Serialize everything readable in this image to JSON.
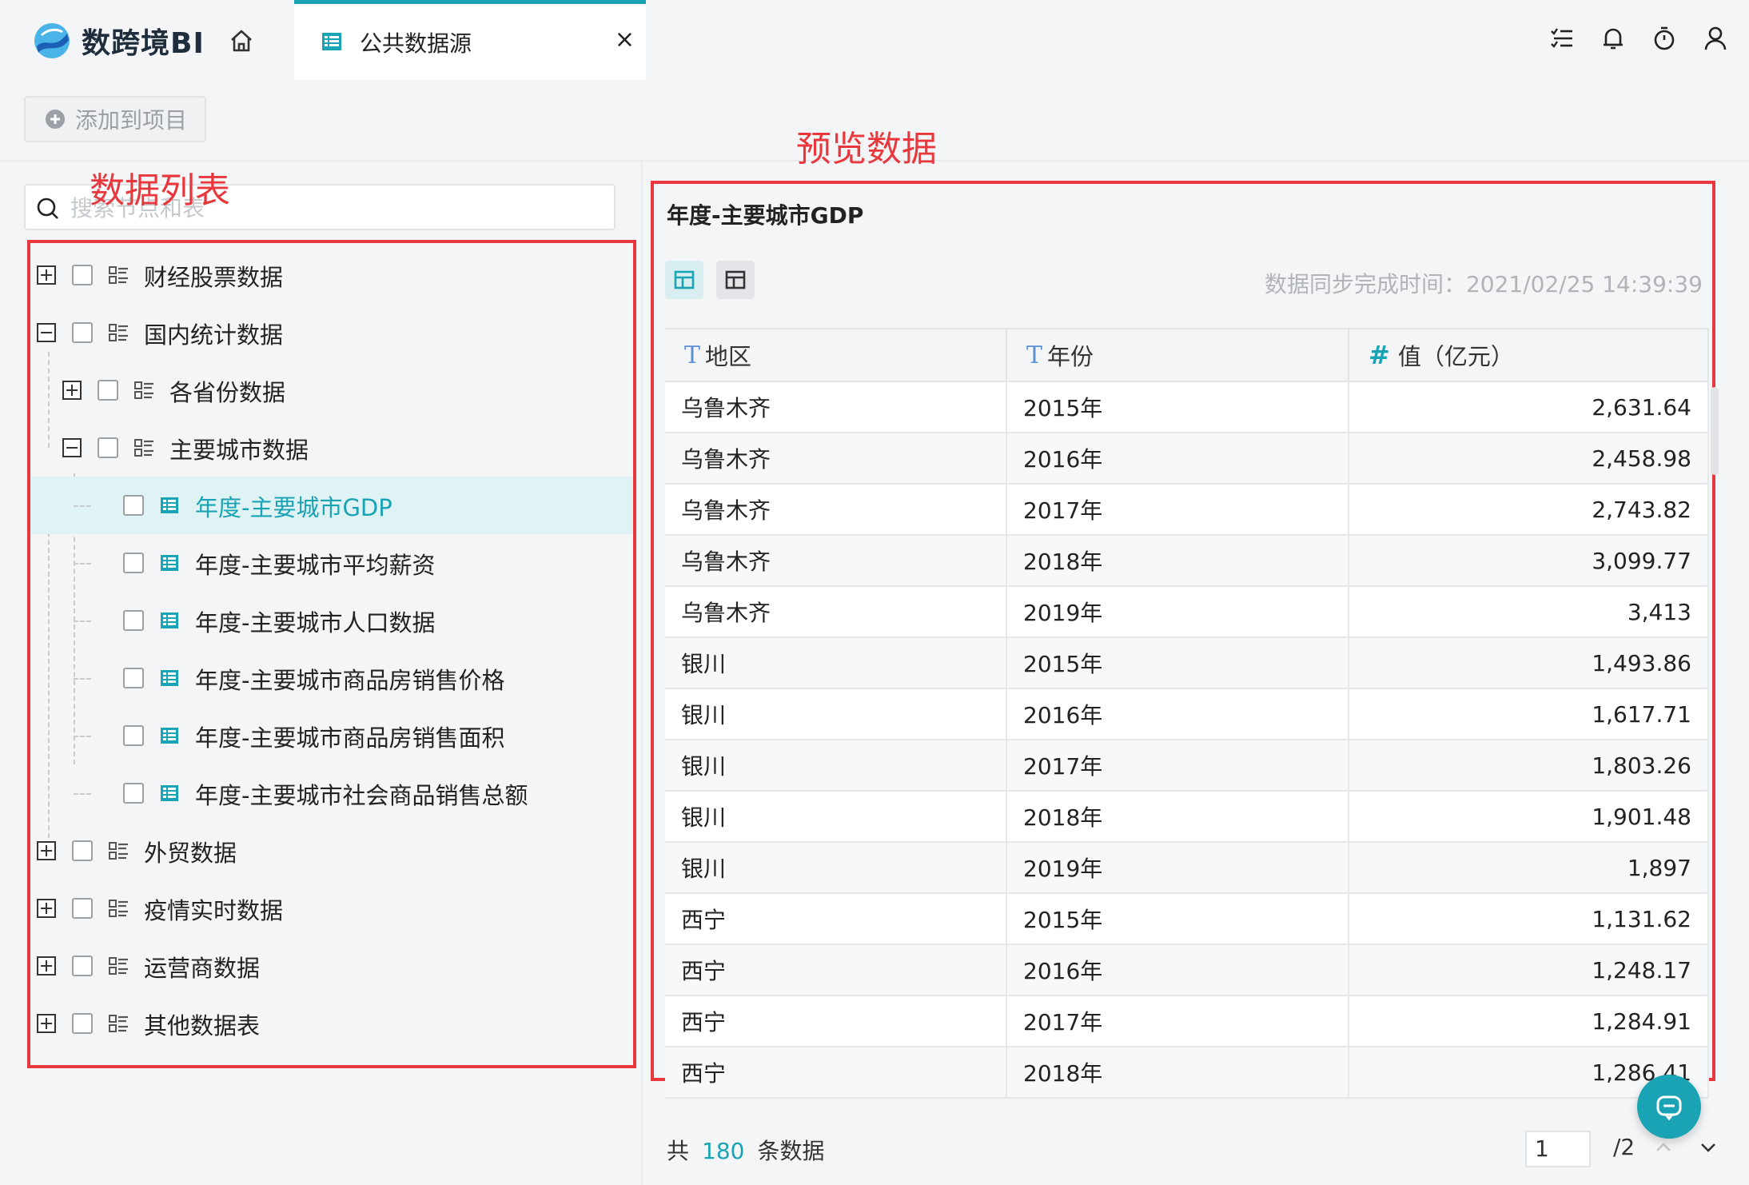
{
  "app": {
    "brand": "数跨境BI"
  },
  "tab": {
    "label": "公共数据源",
    "close": "×"
  },
  "toolbar": {
    "add_label": "添加到项目"
  },
  "search": {
    "placeholder": "搜索节点和表"
  },
  "annotations": {
    "list": "数据列表",
    "preview": "预览数据"
  },
  "tree": [
    {
      "label": "财经股票数据",
      "level": 0,
      "expanded": false,
      "type": "folder"
    },
    {
      "label": "国内统计数据",
      "level": 0,
      "expanded": true,
      "type": "folder"
    },
    {
      "label": "各省份数据",
      "level": 1,
      "expanded": false,
      "type": "folder"
    },
    {
      "label": "主要城市数据",
      "level": 1,
      "expanded": true,
      "type": "folder"
    },
    {
      "label": "年度-主要城市GDP",
      "level": 2,
      "type": "table",
      "selected": true
    },
    {
      "label": "年度-主要城市平均薪资",
      "level": 2,
      "type": "table"
    },
    {
      "label": "年度-主要城市人口数据",
      "level": 2,
      "type": "table"
    },
    {
      "label": "年度-主要城市商品房销售价格",
      "level": 2,
      "type": "table"
    },
    {
      "label": "年度-主要城市商品房销售面积",
      "level": 2,
      "type": "table"
    },
    {
      "label": "年度-主要城市社会商品销售总额",
      "level": 2,
      "type": "table"
    },
    {
      "label": "外贸数据",
      "level": 0,
      "expanded": false,
      "type": "folder"
    },
    {
      "label": "疫情实时数据",
      "level": 0,
      "expanded": false,
      "type": "folder"
    },
    {
      "label": "运营商数据",
      "level": 0,
      "expanded": false,
      "type": "folder"
    },
    {
      "label": "其他数据表",
      "level": 0,
      "expanded": false,
      "type": "folder"
    }
  ],
  "preview": {
    "title": "年度-主要城市GDP",
    "sync_text": "数据同步完成时间：2021/02/25 14:39:39",
    "columns": [
      {
        "type": "T",
        "label": "地区"
      },
      {
        "type": "T",
        "label": "年份"
      },
      {
        "type": "#",
        "label": "值（亿元）"
      }
    ],
    "rows": [
      [
        "乌鲁木齐",
        "2015年",
        "2,631.64"
      ],
      [
        "乌鲁木齐",
        "2016年",
        "2,458.98"
      ],
      [
        "乌鲁木齐",
        "2017年",
        "2,743.82"
      ],
      [
        "乌鲁木齐",
        "2018年",
        "3,099.77"
      ],
      [
        "乌鲁木齐",
        "2019年",
        "3,413"
      ],
      [
        "银川",
        "2015年",
        "1,493.86"
      ],
      [
        "银川",
        "2016年",
        "1,617.71"
      ],
      [
        "银川",
        "2017年",
        "1,803.26"
      ],
      [
        "银川",
        "2018年",
        "1,901.48"
      ],
      [
        "银川",
        "2019年",
        "1,897"
      ],
      [
        "西宁",
        "2015年",
        "1,131.62"
      ],
      [
        "西宁",
        "2016年",
        "1,248.17"
      ],
      [
        "西宁",
        "2017年",
        "1,284.91"
      ],
      [
        "西宁",
        "2018年",
        "1,286.41"
      ]
    ]
  },
  "footer": {
    "prefix": "共",
    "count": "180",
    "suffix": "条数据",
    "page": "1",
    "total": "/2"
  },
  "colors": {
    "accent": "#1aa3b5",
    "annotation": "#e8383d"
  }
}
